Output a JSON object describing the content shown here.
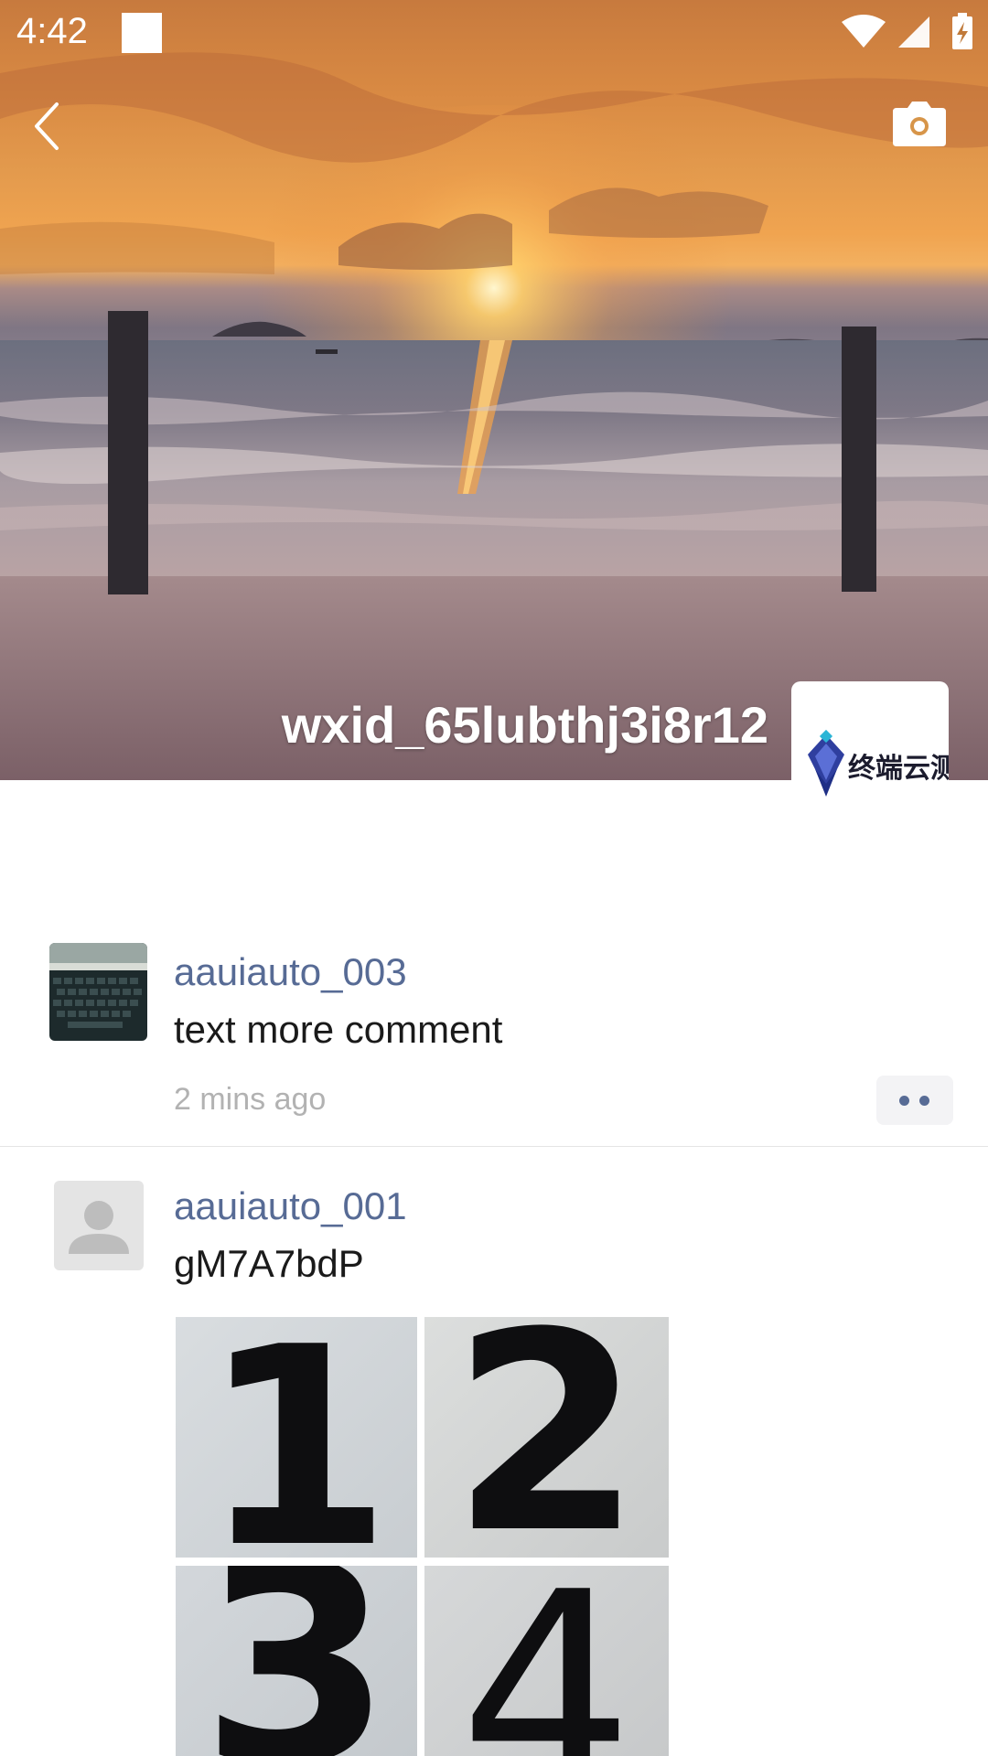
{
  "status_bar": {
    "time": "4:42",
    "icons": [
      "notification-square-icon",
      "wifi-icon",
      "cell-signal-icon",
      "battery-charging-icon"
    ]
  },
  "header": {
    "back_icon": "chevron-left-icon",
    "camera_icon": "camera-icon",
    "profile_name": "wxid_65lubthj3i8r12",
    "avatar_logo_text": "终端云测"
  },
  "feed": [
    {
      "username": "aauiauto_003",
      "text": "text more comment",
      "time": "2 mins ago",
      "avatar": "keyboard-photo",
      "more_icon": "more-dots-icon"
    },
    {
      "username": "aauiauto_001",
      "text": "gM7A7bdP",
      "avatar": "default-user-icon",
      "images": [
        "1",
        "2",
        "3",
        "4"
      ]
    }
  ],
  "colors": {
    "link": "#576b95",
    "timestamp": "#b2b2b2",
    "divider": "#e5e5e5"
  }
}
